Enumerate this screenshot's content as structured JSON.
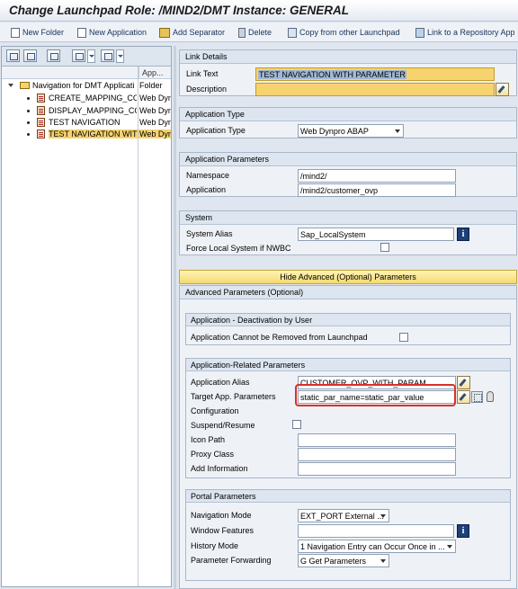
{
  "window": {
    "title": "Change Launchpad Role: /MIND2/DMT Instance: GENERAL"
  },
  "toolbar": {
    "new_folder": "New Folder",
    "new_application": "New Application",
    "add_separator": "Add Separator",
    "delete": "Delete",
    "copy_other": "Copy from other Launchpad",
    "link_repo": "Link to a Repository App"
  },
  "tree": {
    "col_type": "App...",
    "root": {
      "label": "Navigation for DMT Applicati",
      "type": "Folder"
    },
    "items": [
      {
        "label": "CREATE_MAPPING_CON",
        "type": "Web Dyn"
      },
      {
        "label": "DISPLAY_MAPPING_CON",
        "type": "Web Dyn"
      },
      {
        "label": "TEST NAVIGATION",
        "type": "Web Dyn"
      },
      {
        "label": "TEST NAVIGATION WIT",
        "type": "Web Dyn"
      }
    ]
  },
  "link_details": {
    "header": "Link Details",
    "link_text_label": "Link Text",
    "link_text_value": "TEST NAVIGATION WITH PARAMETER",
    "description_label": "Description",
    "description_value": ""
  },
  "app_type": {
    "header": "Application Type",
    "label": "Application Type",
    "value": "Web Dynpro ABAP"
  },
  "app_params": {
    "header": "Application Parameters",
    "namespace_label": "Namespace",
    "namespace_value": "/mind2/",
    "application_label": "Application",
    "application_value": "/mind2/customer_ovp"
  },
  "system": {
    "header": "System",
    "alias_label": "System Alias",
    "alias_value": "Sap_LocalSystem",
    "force_label": "Force Local System if NWBC"
  },
  "hide_adv_button": "Hide Advanced (Optional) Parameters",
  "advanced": {
    "header": "Advanced Parameters (Optional)",
    "deactivation": {
      "header": "Application - Deactivation by User",
      "label": "Application Cannot be Removed from Launchpad"
    },
    "related": {
      "header": "Application-Related Parameters",
      "alias_label": "Application Alias",
      "alias_value": "CUSTOMER_OVP_WITH_PARAM",
      "target_label": "Target App. Parameters",
      "target_value": "static_par_name=static_par_value",
      "config_label": "Configuration",
      "suspend_label": "Suspend/Resume",
      "icon_label": "Icon Path",
      "proxy_label": "Proxy Class",
      "addinfo_label": "Add Information"
    },
    "portal": {
      "header": "Portal Parameters",
      "nav_mode_label": "Navigation Mode",
      "nav_mode_value": "EXT_PORT External ...",
      "window_label": "Window Features",
      "history_label": "History Mode",
      "history_value": "1 Navigation Entry can Occur Once in ...",
      "forward_label": "Parameter Forwarding",
      "forward_value": "G Get Parameters"
    }
  },
  "colors": {
    "highlight": "#f6d36f",
    "frame": "#dfe6ef",
    "annotation": "#d9302c"
  }
}
